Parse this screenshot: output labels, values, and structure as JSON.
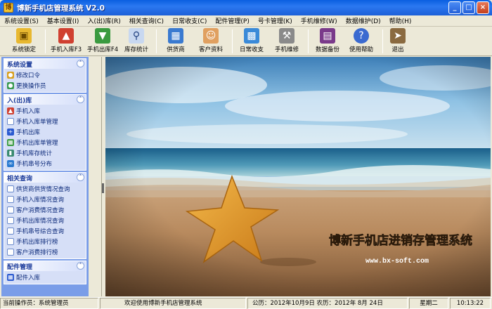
{
  "window": {
    "title": "博新手机店管理系统 V2.0",
    "buttons": {
      "minimize": "_",
      "maximize": "□",
      "close": "×"
    }
  },
  "menubar": [
    "系统设置(S)",
    "基本设置(I)",
    "入(出)库(R)",
    "相关查询(C)",
    "日常收支(C)",
    "配件管理(P)",
    "号卡管理(K)",
    "手机维修(W)",
    "数据维护(D)",
    "帮助(H)"
  ],
  "toolbar": [
    {
      "label": "系统锁定",
      "icon": "lock-icon"
    },
    {
      "label": "手机入库F3",
      "icon": "cart-in-icon"
    },
    {
      "label": "手机出库F4",
      "icon": "cart-out-icon"
    },
    {
      "label": "库存统计",
      "icon": "magnifier-icon"
    },
    {
      "label": "供货商",
      "icon": "building-icon"
    },
    {
      "label": "客户资料",
      "icon": "contact-card-icon"
    },
    {
      "label": "日常收支",
      "icon": "cash-register-icon"
    },
    {
      "label": "手机维修",
      "icon": "tools-icon"
    },
    {
      "label": "数据备份",
      "icon": "floppy-disk-icon"
    },
    {
      "label": "使用帮助",
      "icon": "help-icon"
    },
    {
      "label": "退出",
      "icon": "exit-door-icon"
    }
  ],
  "sidebar": {
    "groups": [
      {
        "title": "系统设置",
        "items": [
          {
            "label": "修改口令",
            "icon": "key-icon"
          },
          {
            "label": "更换操作员",
            "icon": "users-icon"
          }
        ]
      },
      {
        "title": "入(出)库",
        "items": [
          {
            "label": "手机入库",
            "icon": "cart-in-icon"
          },
          {
            "label": "手机入库单管理",
            "icon": "document-icon"
          },
          {
            "label": "手机出库",
            "icon": "plus-icon"
          },
          {
            "label": "手机出库单管理",
            "icon": "grid-icon"
          },
          {
            "label": "手机库存统计",
            "icon": "chart-icon"
          },
          {
            "label": "手机串号分布",
            "icon": "link-icon"
          }
        ]
      },
      {
        "title": "相关查询",
        "items": [
          {
            "label": "供货商供货情况查询",
            "icon": "document-icon"
          },
          {
            "label": "手机入库情况查询",
            "icon": "document-icon"
          },
          {
            "label": "客户消费情况查询",
            "icon": "document-icon"
          },
          {
            "label": "手机出库情况查询",
            "icon": "document-icon"
          },
          {
            "label": "手机串号综合查询",
            "icon": "document-icon"
          },
          {
            "label": "手机出库排行榜",
            "icon": "document-icon"
          },
          {
            "label": "客户消费排行榜",
            "icon": "document-icon"
          }
        ]
      },
      {
        "title": "配件管理",
        "items": [
          {
            "label": "配件入库",
            "icon": "book-icon"
          }
        ]
      }
    ]
  },
  "content": {
    "banner_title": "博新手机店进销存管理系统",
    "banner_url": "www.bx-soft.com"
  },
  "statusbar": {
    "operator": "当前操作员：系统管理员",
    "welcome": "欢迎使用博新手机店管理系统",
    "date": "公历：2012年10月9日  农历：2012年 8月 24日",
    "weekday": "星期二",
    "time": "10:13:22"
  },
  "colors": {
    "titlebar": "#0a5fe0",
    "sidebar_bg": "#7a9de8",
    "group_body": "#d6dff7",
    "group_text": "#0c2a7a"
  }
}
